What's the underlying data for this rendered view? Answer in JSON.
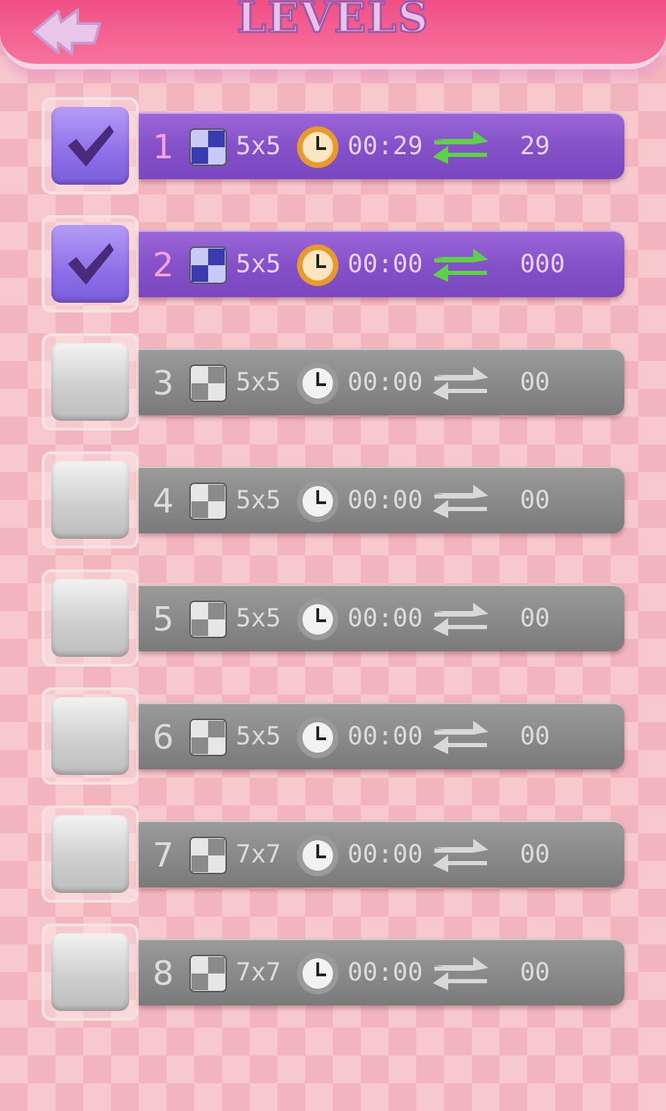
{
  "header": {
    "title": "LEVELS"
  },
  "levels": [
    {
      "number": "1",
      "size": "5x5",
      "time": "00:29",
      "moves": "29",
      "completed": true
    },
    {
      "number": "2",
      "size": "5x5",
      "time": "00:00",
      "moves": "000",
      "completed": true
    },
    {
      "number": "3",
      "size": "5x5",
      "time": "00:00",
      "moves": "00",
      "completed": false
    },
    {
      "number": "4",
      "size": "5x5",
      "time": "00:00",
      "moves": "00",
      "completed": false
    },
    {
      "number": "5",
      "size": "5x5",
      "time": "00:00",
      "moves": "00",
      "completed": false
    },
    {
      "number": "6",
      "size": "5x5",
      "time": "00:00",
      "moves": "00",
      "completed": false
    },
    {
      "number": "7",
      "size": "7x7",
      "time": "00:00",
      "moves": "00",
      "completed": false
    },
    {
      "number": "8",
      "size": "7x7",
      "time": "00:00",
      "moves": "00",
      "completed": false
    }
  ]
}
